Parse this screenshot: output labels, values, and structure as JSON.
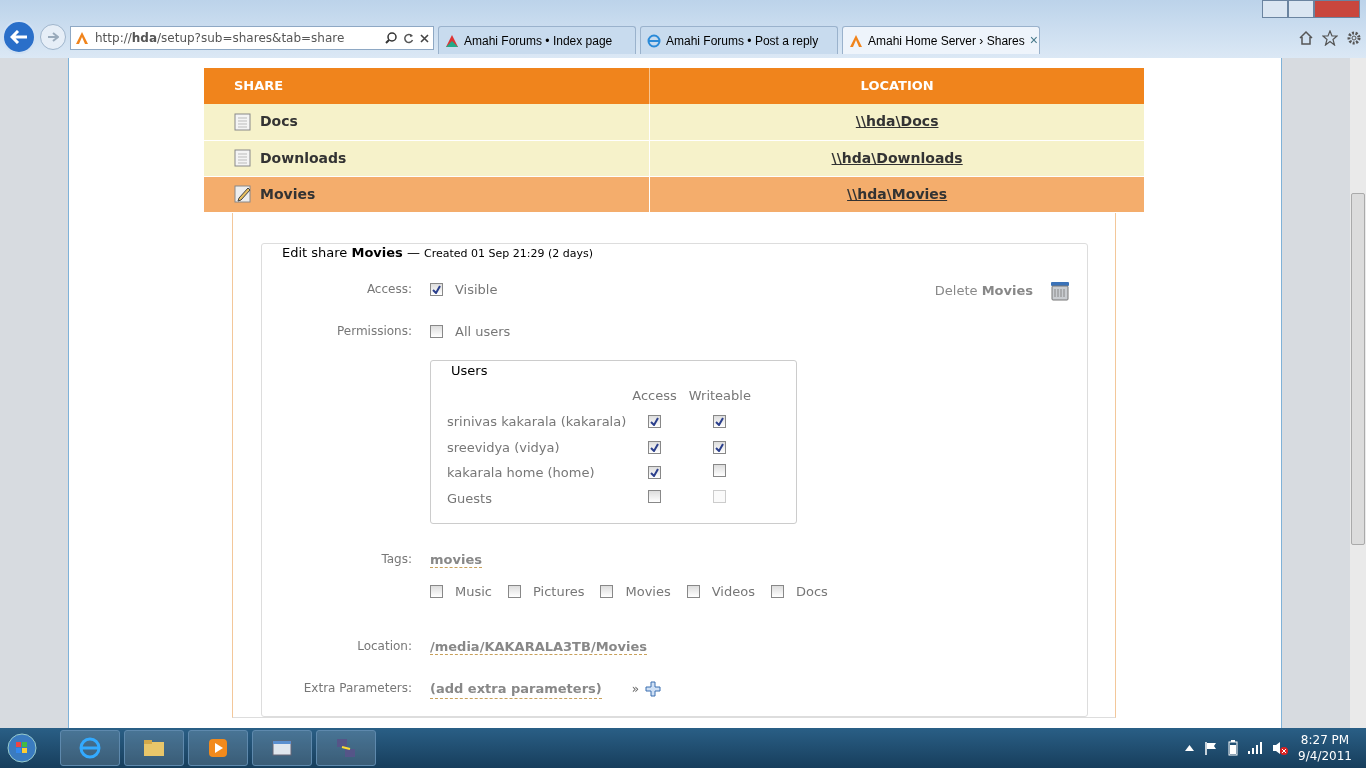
{
  "browser": {
    "address": "http://**hda**/setup?sub=shares&tab=share",
    "tabs": [
      {
        "title": "Amahi Forums • Index page",
        "selected": false,
        "kind": "forum"
      },
      {
        "title": "Amahi Forums • Post a reply",
        "selected": false,
        "kind": "ie"
      },
      {
        "title": "Amahi Home Server › Shares",
        "selected": true,
        "kind": "amahi"
      }
    ],
    "close_tab": "×"
  },
  "shares": {
    "columns": [
      "SHARE",
      "LOCATION"
    ],
    "rows": [
      {
        "name": "Docs",
        "location": "\\\\hda\\Docs",
        "selected": false
      },
      {
        "name": "Downloads",
        "location": "\\\\hda\\Downloads",
        "selected": false
      },
      {
        "name": "Movies",
        "location": "\\\\hda\\Movies",
        "selected": true
      }
    ]
  },
  "edit": {
    "title": "Edit share **Movies** —",
    "created": "Created 01 Sep 21:29 (2 days)",
    "access": {
      "label": "Access:",
      "option": "Visible",
      "checked": true
    },
    "delete": "Delete **Movies**",
    "permissions": {
      "label": "Permissions:",
      "option": "All users",
      "checked": false
    },
    "users": {
      "legend": "Users",
      "columns": [
        "Access",
        "Writeable"
      ],
      "rows": [
        {
          "name": "srinivas kakarala (kakarala)",
          "access": true,
          "writeable": true,
          "writeable_disabled": false
        },
        {
          "name": "sreevidya (vidya)",
          "access": true,
          "writeable": true,
          "writeable_disabled": false
        },
        {
          "name": "kakarala home (home)",
          "access": true,
          "writeable": false,
          "writeable_disabled": false
        },
        {
          "name": "Guests",
          "access": false,
          "writeable": false,
          "writeable_disabled": true
        }
      ]
    },
    "tags": {
      "label": "Tags:",
      "value": "movies",
      "options": [
        {
          "label": "Music",
          "checked": false
        },
        {
          "label": "Pictures",
          "checked": false
        },
        {
          "label": "Movies",
          "checked": false
        },
        {
          "label": "Videos",
          "checked": false
        },
        {
          "label": "Docs",
          "checked": false
        }
      ]
    },
    "location": {
      "label": "Location:",
      "value": "/media/KAKARALA3TB/Movies"
    },
    "extra": {
      "label": "Extra Parameters:",
      "value": "(add extra parameters)",
      "arrow": "»"
    }
  },
  "taskbar": {
    "time": "8:27 PM",
    "date": "9/4/2011"
  }
}
